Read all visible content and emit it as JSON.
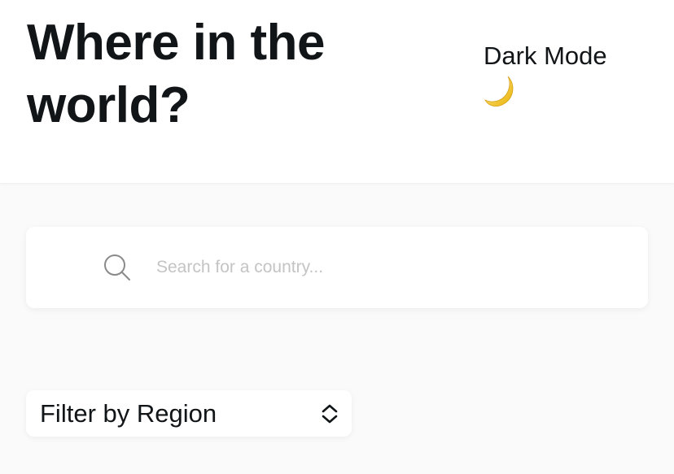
{
  "header": {
    "title": "Where in the world?",
    "theme_toggle": {
      "label": "Dark Mode",
      "icon": "crescent-moon-icon"
    }
  },
  "search": {
    "icon": "search-icon",
    "value": "",
    "placeholder": "Search for a country..."
  },
  "filter": {
    "label": "Filter by Region",
    "icon": "up-down-chevron-icon"
  },
  "colors": {
    "background": "#fafafa",
    "surface": "#ffffff",
    "text": "#111517",
    "placeholder": "#c4c4c4",
    "moon": "#f5c842"
  }
}
